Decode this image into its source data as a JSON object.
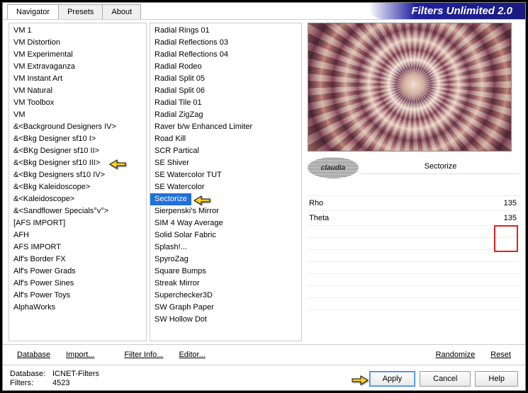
{
  "title": "Filters Unlimited 2.0",
  "tabs": [
    "Navigator",
    "Presets",
    "About"
  ],
  "active_tab": 0,
  "categories": [
    "VM 1",
    "VM Distortion",
    "VM Experimental",
    "VM Extravaganza",
    "VM Instant Art",
    "VM Natural",
    "VM Toolbox",
    "VM",
    "&<Background Designers IV>",
    "&<Bkg Designer sf10 I>",
    "&<BKg Designer sf10 II>",
    "&<Bkg Designer sf10 III>",
    "&<Bkg Designers sf10 IV>",
    "&<Bkg Kaleidoscope>",
    "&<Kaleidoscope>",
    "&<Sandflower Specials°v°>",
    "[AFS IMPORT]",
    "AFH",
    "AFS IMPORT",
    "Alf's Border FX",
    "Alf's Power Grads",
    "Alf's Power Sines",
    "Alf's Power Toys",
    "AlphaWorks"
  ],
  "highlighted_category_index": 11,
  "filters": [
    "Radial  Rings 01",
    "Radial Reflections 03",
    "Radial Reflections 04",
    "Radial Rodeo",
    "Radial Split 05",
    "Radial Split 06",
    "Radial Tile 01",
    "Radial ZigZag",
    "Raver b/w Enhanced Limiter",
    "Road Kill",
    "SCR  Partical",
    "SE Shiver",
    "SE Watercolor TUT",
    "SE Watercolor",
    "Sectorize",
    "Sierpenski's Mirror",
    "SIM 4 Way Average",
    "Solid Solar Fabric",
    "Splash!...",
    "SpyroZag",
    "Square Bumps",
    "Streak Mirror",
    "Superchecker3D",
    "SW Graph Paper",
    "SW Hollow Dot"
  ],
  "selected_filter_index": 14,
  "current_filter": "Sectorize",
  "logo_text": "claudia",
  "params": [
    {
      "name": "Rho",
      "value": "135"
    },
    {
      "name": "Theta",
      "value": "135"
    }
  ],
  "toolbar": {
    "database": "Database",
    "import": "Import...",
    "filter_info": "Filter Info...",
    "editor": "Editor...",
    "randomize": "Randomize",
    "reset": "Reset"
  },
  "footer": {
    "db_label": "Database:",
    "db_value": "ICNET-Filters",
    "filters_label": "Filters:",
    "filters_value": "4523",
    "apply": "Apply",
    "cancel": "Cancel",
    "help": "Help"
  }
}
